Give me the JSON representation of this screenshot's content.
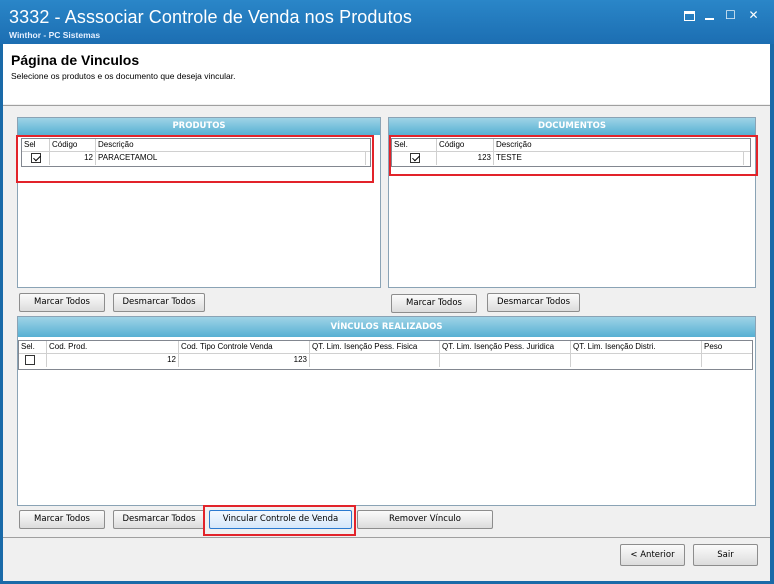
{
  "window": {
    "title": "3332 - Asssociar Controle de Venda nos Produtos",
    "subtitle": "Winthor - PC Sistemas"
  },
  "page": {
    "title": "Página de Vinculos",
    "description": "Selecione os produtos e os documento que deseja vincular."
  },
  "produtos": {
    "header": "PRODUTOS",
    "columns": [
      "Sel",
      "Código",
      "Descrição"
    ],
    "rows": [
      {
        "selected": true,
        "codigo": "12",
        "descricao": "PARACETAMOL"
      }
    ],
    "marcar_todos": "Marcar Todos",
    "desmarcar_todos": "Desmarcar Todos"
  },
  "documentos": {
    "header": "DOCUMENTOS",
    "columns": [
      "Sel.",
      "Código",
      "Descrição"
    ],
    "rows": [
      {
        "selected": true,
        "codigo": "123",
        "descricao": "TESTE"
      }
    ],
    "marcar_todos": "Marcar Todos",
    "desmarcar_todos": "Desmarcar Todos"
  },
  "vinculos": {
    "header": "VÍNCULOS REALIZADOS",
    "columns": [
      "Sel.",
      "Cod. Prod.",
      "Cod. Tipo Controle Venda",
      "QT. Lim. Isenção Pess. Fisica",
      "QT. Lim. Isenção Pess. Juridica",
      "QT. Lim. Isenção Distri.",
      "Peso"
    ],
    "rows": [
      {
        "selected": false,
        "cod_prod": "12",
        "cod_tipo": "123",
        "qt_fisica": "",
        "qt_juridica": "",
        "qt_distri": "",
        "peso": ""
      }
    ],
    "marcar_todos": "Marcar Todos",
    "desmarcar_todos": "Desmarcar Todos",
    "vincular": "Vincular Controle de Venda",
    "remover": "Remover Vínculo"
  },
  "footer": {
    "anterior": "< Anterior",
    "sair": "Sair"
  },
  "colors": {
    "highlight": "#e2232a",
    "titlebar": "#1c6eb2",
    "panel_header": "#56b0d3"
  }
}
